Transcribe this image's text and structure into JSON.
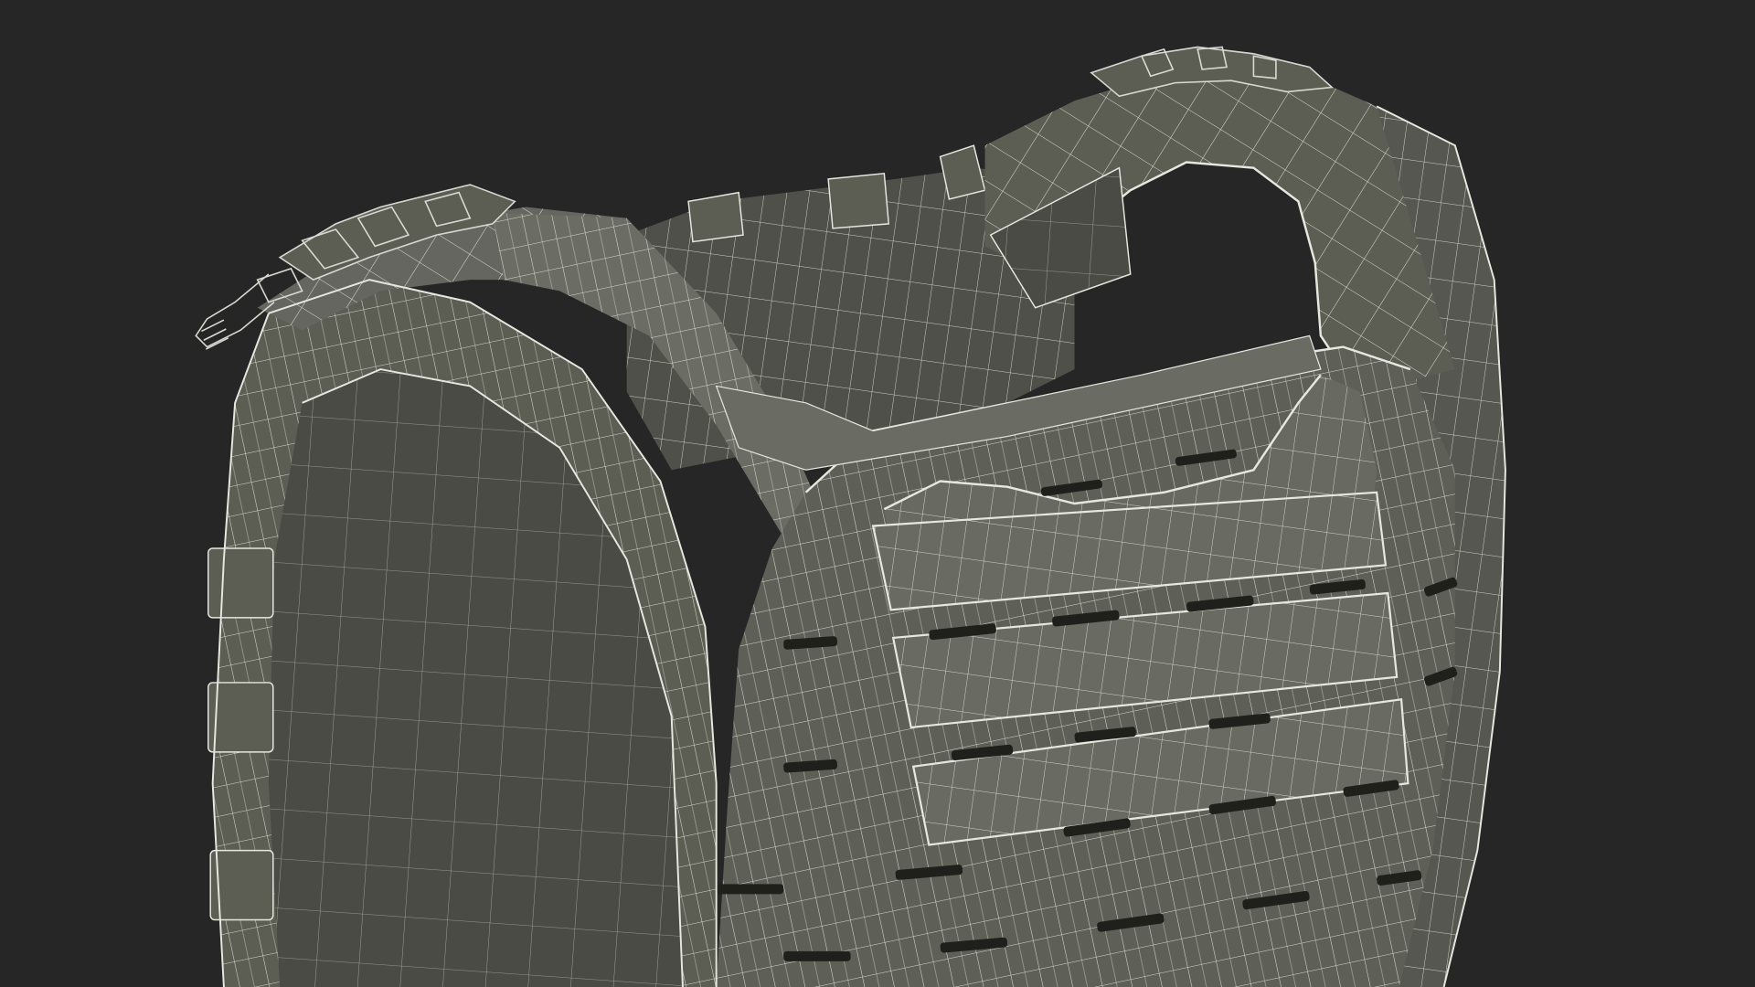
{
  "scene": {
    "subject": "vest-wireframe",
    "colors": {
      "background": "#262626",
      "fabric": "#5c5d53",
      "fabric_light": "#70716a",
      "fabric_dark": "#3e3f38",
      "interior": "#4a4b44",
      "wire": "#e6e7de",
      "slot": "#1f201c",
      "hardware": "#d8d9d2"
    }
  }
}
